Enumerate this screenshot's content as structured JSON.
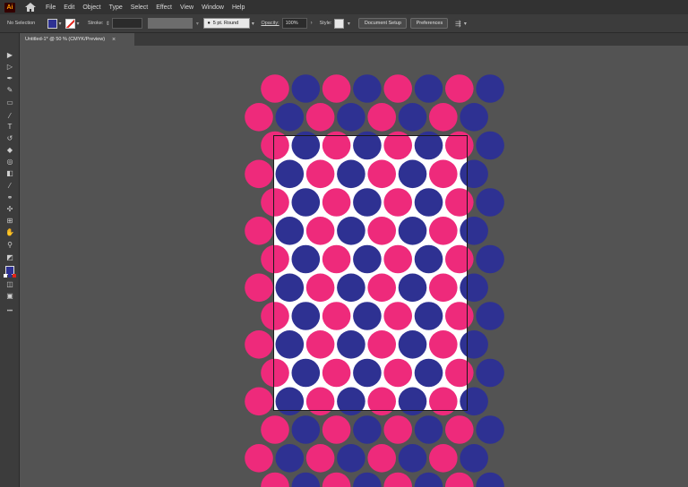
{
  "app": {
    "logo_text": "Ai"
  },
  "menu": [
    "File",
    "Edit",
    "Object",
    "Type",
    "Select",
    "Effect",
    "View",
    "Window",
    "Help"
  ],
  "control": {
    "selection_label": "No Selection",
    "stroke_label": "Stroke:",
    "brush_value": "5 pt. Round",
    "opacity_label": "Opacity:",
    "opacity_value": "100%",
    "style_label": "Style:",
    "document_setup": "Document Setup",
    "preferences": "Preferences"
  },
  "document_tab": {
    "title": "Untitled-1* @ 50 % (CMYK/Preview)",
    "close": "×"
  },
  "colors": {
    "pink": "#ee2a7b",
    "navy": "#2e3192",
    "canvas": "#535353",
    "artboard": "#ffffff"
  },
  "tools": [
    "selection-icon",
    "direct-selection-icon",
    "pen-icon",
    "curvature-icon",
    "rectangle-icon",
    "paintbrush-icon",
    "type-icon",
    "rotate-icon",
    "eraser-icon",
    "warp-icon",
    "gradient-icon",
    "eyedropper-icon",
    "blend-icon",
    "symbol-sprayer-icon",
    "artboard-icon",
    "hand-icon",
    "zoom-icon",
    "default-colors-icon",
    "fill-stroke-icon",
    "color-mode-icon",
    "draw-mode-icon",
    "screen-mode-icon",
    "more-tools-icon"
  ],
  "pattern": {
    "rows": [
      {
        "start": "pink",
        "count": 8
      },
      {
        "start": "pink",
        "count": 8
      },
      {
        "start": "pink",
        "count": 8
      },
      {
        "start": "pink",
        "count": 8
      },
      {
        "start": "pink",
        "count": 8
      },
      {
        "start": "pink",
        "count": 8
      },
      {
        "start": "pink",
        "count": 8
      },
      {
        "start": "pink",
        "count": 8
      },
      {
        "start": "pink",
        "count": 8
      },
      {
        "start": "pink",
        "count": 8
      },
      {
        "start": "pink",
        "count": 8
      },
      {
        "start": "pink",
        "count": 8
      },
      {
        "start": "pink",
        "count": 8
      },
      {
        "start": "pink",
        "count": 8
      },
      {
        "start": "pink",
        "count": 8
      }
    ]
  }
}
